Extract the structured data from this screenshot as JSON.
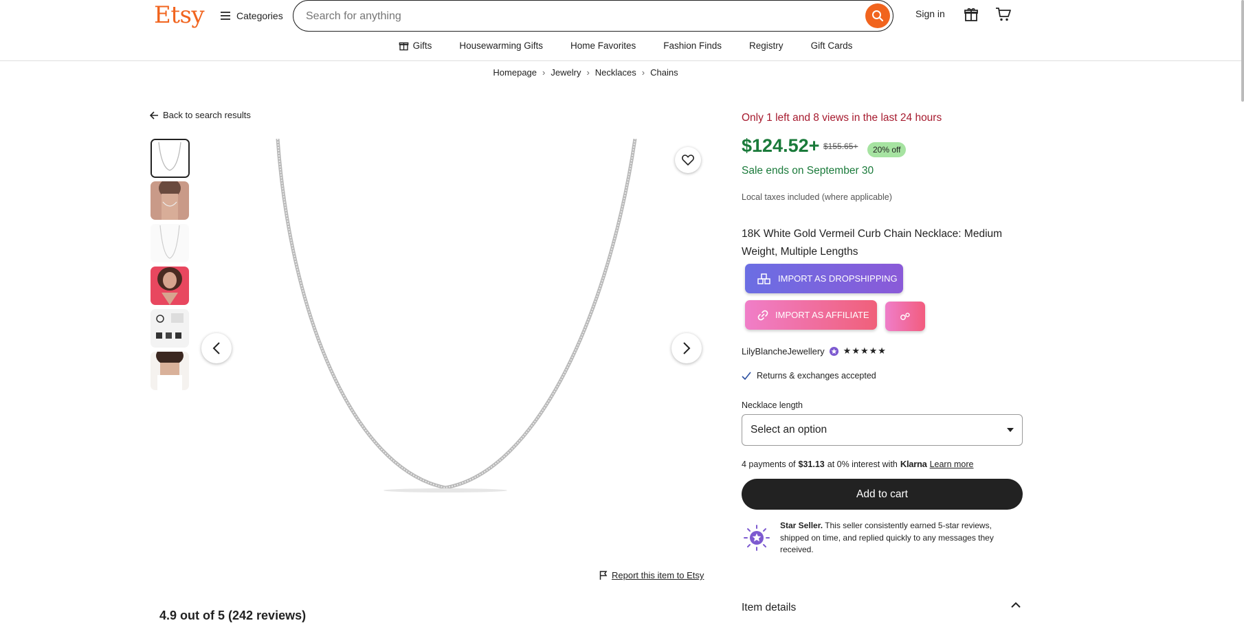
{
  "header": {
    "logo": "Etsy",
    "categories_label": "Categories",
    "search_placeholder": "Search for anything",
    "signin_label": "Sign in"
  },
  "nav": {
    "items": [
      {
        "label": "Gifts",
        "icon": "gift-icon"
      },
      {
        "label": "Housewarming Gifts"
      },
      {
        "label": "Home Favorites"
      },
      {
        "label": "Fashion Finds"
      },
      {
        "label": "Registry"
      },
      {
        "label": "Gift Cards"
      }
    ]
  },
  "breadcrumb": [
    "Homepage",
    "Jewelry",
    "Necklaces",
    "Chains"
  ],
  "gallery": {
    "back_label": "Back to search results",
    "thumbnails": [
      "chain-product",
      "model-neck",
      "chain-white",
      "model-red-top",
      "packaging",
      "model-white-top"
    ],
    "report_label": "Report this item to Etsy"
  },
  "reviews_heading_partial": "4.9 out of 5 (242 reviews)",
  "product": {
    "urgency": "Only 1 left and 8 views in the last 24 hours",
    "price": "$124.52+",
    "original_price": "$155.65+",
    "discount_badge": "20% off",
    "sale_ends": "Sale ends on September 30",
    "taxes_note": "Local taxes included (where applicable)",
    "title": "18K White Gold Vermeil Curb Chain Necklace: Medium Weight, Multiple Lengths",
    "import_dropshipping_label": "IMPORT AS DROPSHIPPING",
    "import_affiliate_label": "IMPORT AS AFFILIATE",
    "seller_name": "LilyBlancheJewellery",
    "rating_stars": "★★★★★",
    "returns_label": "Returns & exchanges accepted",
    "necklace_length_label": "Necklace length",
    "select_value": "Select an option",
    "klarna": {
      "prefix": "4 payments of",
      "amount": "$31.13",
      "middle": "at 0% interest with",
      "brand": "Klarna",
      "link": "Learn more"
    },
    "add_to_cart_label": "Add to cart",
    "star_seller": {
      "title": "Star Seller.",
      "text": "This seller consistently earned 5-star reviews, shipped on time, and replied quickly to any messages they received."
    },
    "item_details_label": "Item details"
  },
  "colors": {
    "brand": "#f1641e",
    "sale_green": "#1a7a3a",
    "urgency_red": "#a61a2e"
  }
}
